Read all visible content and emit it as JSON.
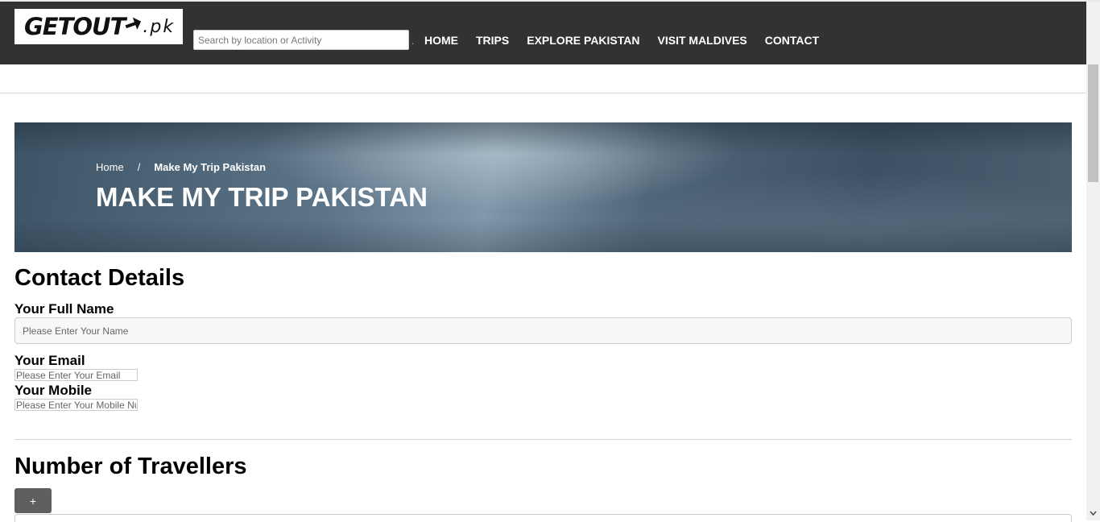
{
  "header": {
    "logo_text": "GETOUT",
    "logo_suffix": ".pk",
    "search_placeholder": "Search by location or Activity",
    "search_dot": ".",
    "nav": [
      {
        "label": "HOME"
      },
      {
        "label": "TRIPS"
      },
      {
        "label": "EXPLORE PAKISTAN"
      },
      {
        "label": "VISIT MALDIVES"
      },
      {
        "label": "CONTACT"
      }
    ]
  },
  "banner": {
    "breadcrumb_home": "Home",
    "breadcrumb_sep": "/",
    "breadcrumb_current": "Make My Trip Pakistan",
    "title": "MAKE MY TRIP PAKISTAN"
  },
  "contact": {
    "heading": "Contact Details",
    "name_label": "Your Full Name",
    "name_placeholder": "Please Enter Your Name",
    "email_label": "Your Email",
    "email_placeholder": "Please Enter Your Email",
    "mobile_label": "Your Mobile",
    "mobile_placeholder": "Please Enter Your Mobile Number"
  },
  "travellers": {
    "heading": "Number of Travellers",
    "add_label": "+"
  },
  "colors": {
    "navbar_bg": "#323232",
    "button_bg": "#5f5f5f"
  },
  "icons": {
    "logo_arrow": "arrow-right-icon",
    "scroll_down": "chevron-down-icon"
  }
}
